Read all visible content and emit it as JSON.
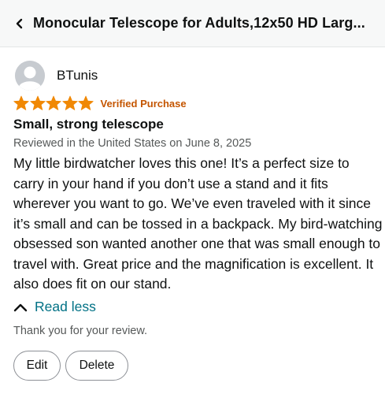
{
  "header": {
    "back_icon": "chevron-left-icon",
    "title": "Monocular Telescope for Adults,12x50 HD Larg..."
  },
  "review": {
    "reviewer_name": "BTunis",
    "avatar_icon": "user-avatar-icon",
    "rating": 5,
    "rating_max": 5,
    "star_color": "#f08804",
    "verified_label": "Verified Purchase",
    "title": "Small, strong telescope",
    "date": "Reviewed in the United States on June 8, 2025",
    "body": "My little birdwatcher loves this one! It’s a perfect size to carry in your hand if you don’t use a stand and it fits wherever you want to go. We’ve even traveled with it since it’s small and can be tossed in a backpack. My bird-watching obsessed son wanted another one that was small enough to travel with. Great price and the magnification is excellent. It also does fit on our stand."
  },
  "read_less": {
    "icon": "chevron-up-icon",
    "label": "Read less"
  },
  "thanks_text": "Thank you for your review.",
  "actions": {
    "edit_label": "Edit",
    "delete_label": "Delete"
  },
  "colors": {
    "link": "#007185",
    "verified": "#c45500",
    "secondary_text": "#565959"
  }
}
